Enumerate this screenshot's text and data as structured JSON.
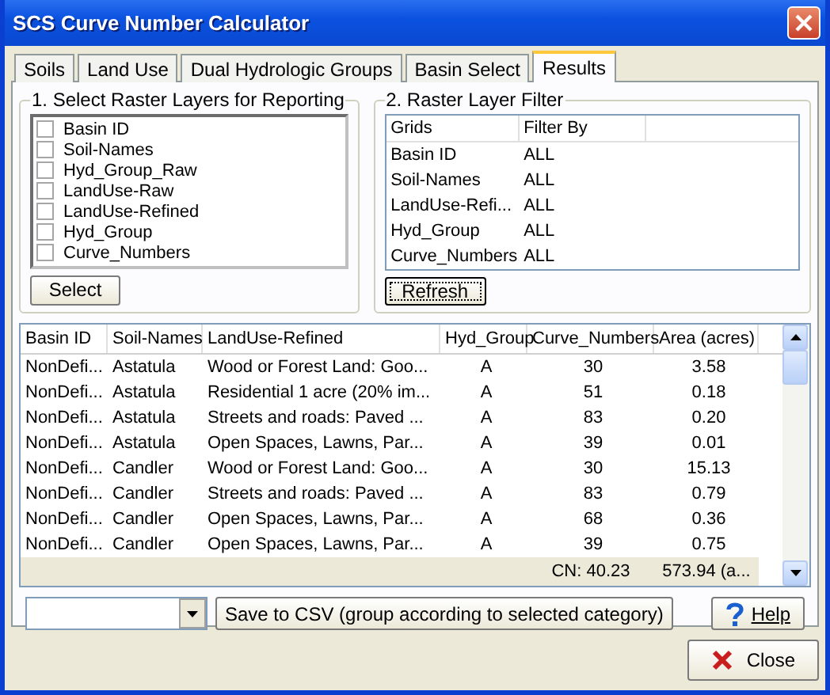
{
  "window": {
    "title": "SCS Curve Number Calculator"
  },
  "tabs": [
    {
      "label": "Soils",
      "selected": false
    },
    {
      "label": "Land Use",
      "selected": false
    },
    {
      "label": "Dual Hydrologic Groups",
      "selected": false
    },
    {
      "label": "Basin Select",
      "selected": false
    },
    {
      "label": "Results",
      "selected": true
    }
  ],
  "layers_group": {
    "title": "1. Select Raster Layers for Reporting",
    "items": [
      {
        "label": "Basin ID",
        "checked": false
      },
      {
        "label": "Soil-Names",
        "checked": false
      },
      {
        "label": "Hyd_Group_Raw",
        "checked": false
      },
      {
        "label": "LandUse-Raw",
        "checked": false
      },
      {
        "label": "LandUse-Refined",
        "checked": false
      },
      {
        "label": "Hyd_Group",
        "checked": false
      },
      {
        "label": "Curve_Numbers",
        "checked": false
      }
    ],
    "button": "Select"
  },
  "filter_group": {
    "title": "2. Raster Layer Filter",
    "columns": [
      "Grids",
      "Filter By"
    ],
    "rows": [
      [
        "Basin ID",
        "ALL"
      ],
      [
        "Soil-Names",
        "ALL"
      ],
      [
        "LandUse-Refi...",
        "ALL"
      ],
      [
        "Hyd_Group",
        "ALL"
      ],
      [
        "Curve_Numbers",
        "ALL"
      ]
    ],
    "button": "Refresh"
  },
  "results_table": {
    "columns": [
      "Basin ID",
      "Soil-Names",
      "LandUse-Refined",
      "Hyd_Group",
      "Curve_Numbers",
      "Area (acres)"
    ],
    "rows": [
      [
        "NonDefi...",
        "Astatula",
        "Wood or Forest Land: Goo...",
        "A",
        "30",
        "3.58"
      ],
      [
        "NonDefi...",
        "Astatula",
        "Residential 1 acre (20% im...",
        "A",
        "51",
        "0.18"
      ],
      [
        "NonDefi...",
        "Astatula",
        "Streets and roads: Paved ...",
        "A",
        "83",
        "0.20"
      ],
      [
        "NonDefi...",
        "Astatula",
        "Open Spaces, Lawns, Par...",
        "A",
        "39",
        "0.01"
      ],
      [
        "NonDefi...",
        "Candler",
        "Wood or Forest Land: Goo...",
        "A",
        "30",
        "15.13"
      ],
      [
        "NonDefi...",
        "Candler",
        "Streets and roads: Paved ...",
        "A",
        "83",
        "0.79"
      ],
      [
        "NonDefi...",
        "Candler",
        "Open Spaces, Lawns, Par...",
        "A",
        "68",
        "0.36"
      ],
      [
        "NonDefi...",
        "Candler",
        "Open Spaces, Lawns, Par...",
        "A",
        "39",
        "0.75"
      ]
    ],
    "totals": [
      "CN: 40.23",
      "573.94 (a..."
    ]
  },
  "save_button": "Save to CSV (group according to selected category)",
  "help_button": "Help",
  "close_button": "Close"
}
